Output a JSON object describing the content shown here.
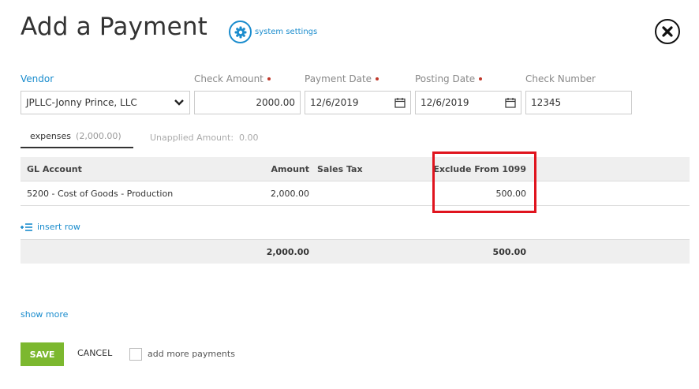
{
  "page": {
    "title": "Add a Payment",
    "system_settings_label": "system settings",
    "icons": {
      "settings": "gear-icon",
      "close": "close-icon",
      "calendar": "calendar-icon",
      "dropdown": "chevron-down-icon",
      "insert": "insert-row-icon"
    }
  },
  "form": {
    "vendor_label": "Vendor",
    "vendor_value": "JPLLC-Jonny Prince, LLC",
    "check_amount_label": "Check Amount",
    "check_amount_value": "2000.00",
    "payment_date_label": "Payment Date",
    "payment_date_value": "12/6/2019",
    "posting_date_label": "Posting Date",
    "posting_date_value": "12/6/2019",
    "check_number_label": "Check Number",
    "check_number_value": "12345"
  },
  "tabs": {
    "expenses_label": "expenses",
    "expenses_amount": "(2,000.00)",
    "unapplied_label": "Unapplied Amount:",
    "unapplied_value": "0.00"
  },
  "grid": {
    "headers": {
      "gl_account": "GL Account",
      "amount": "Amount",
      "sales_tax": "Sales Tax",
      "exclude_1099": "Exclude From 1099"
    },
    "rows": [
      {
        "gl_account": "5200 - Cost of Goods - Production",
        "amount": "2,000.00",
        "sales_tax": "",
        "exclude_1099": "500.00"
      }
    ],
    "totals": {
      "amount": "2,000.00",
      "exclude_1099": "500.00"
    }
  },
  "actions": {
    "insert_row_label": "insert row",
    "show_more_label": "show more",
    "save_label": "SAVE",
    "cancel_label": "CANCEL",
    "add_more_label": "add more payments"
  },
  "colors": {
    "accent": "#1a8ccd",
    "save": "#7cb82f",
    "required": "#c0392b",
    "highlight": "#e0141e"
  }
}
